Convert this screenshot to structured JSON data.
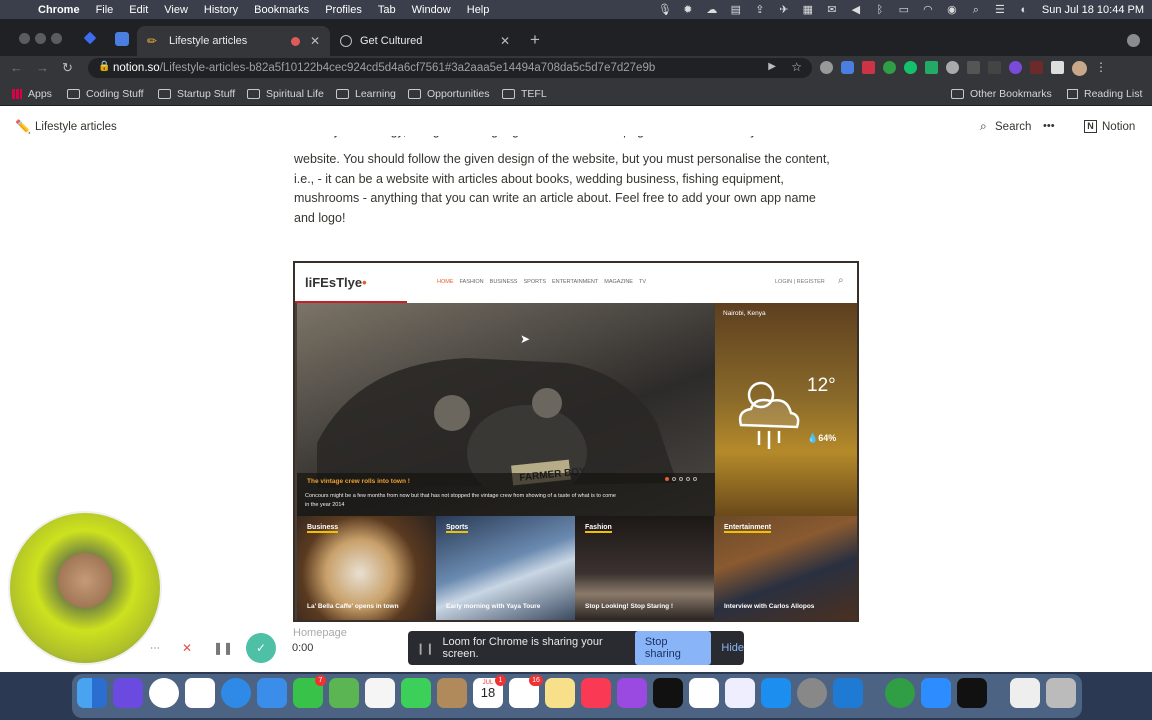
{
  "menubar": {
    "apple": "",
    "app": "Chrome",
    "items": [
      "File",
      "Edit",
      "View",
      "History",
      "Bookmarks",
      "Profiles",
      "Tab",
      "Window",
      "Help"
    ],
    "clock": "Sun Jul 18  10:44 PM"
  },
  "tabs": [
    {
      "title": "Lifestyle articles",
      "active": true
    },
    {
      "title": "Get Cultured",
      "active": false
    }
  ],
  "address": {
    "host": "notion.so",
    "path": "/Lifestyle-articles-b82a5f10122b4cec924cd5d4a6cf7561#3a2aaa5e14494a708da5c5d7e7d27e9b"
  },
  "bookmarks": {
    "apps": "Apps",
    "folders": [
      "Coding Stuff",
      "Startup Stuff",
      "Spiritual Life",
      "Learning",
      "Opportunities",
      "TEFL"
    ],
    "other": "Other Bookmarks",
    "reading": "Reading List"
  },
  "notion": {
    "page_title": "Lifestyle articles",
    "page_icon": "✏️",
    "search": "Search",
    "more": "•••",
    "notion_label": "Notion",
    "paragraph_lines": [
      "website. You should follow the given design of the website, but you must personalise the content,",
      "i.e., - it can be a website with articles about books, wedding business, fishing equipment,",
      "mushrooms - anything that you can write an article about. Feel free to add your own app name",
      "and logo!"
    ],
    "bottom_partial": "Homepage"
  },
  "mockup": {
    "logo": "liFEsTlye",
    "nav": [
      "HOME",
      "FASHION",
      "BUSINESS",
      "SPORTS",
      "ENTERTAINMENT",
      "MAGAZINE",
      "TV"
    ],
    "login": "LOGIN | REGISTER",
    "hero_title": "The vintage crew rolls into town !",
    "hero_desc_1": "Concours might be a few months from now but that has not  stopped the vintage crew from showing of  a taste of what is to come",
    "hero_desc_2": "in the year 2014",
    "plate": "FARMER BOY",
    "weather": {
      "city": "Nairobi, Kenya",
      "temp": "12°",
      "humidity": "64%"
    },
    "cards": [
      {
        "label": "Business",
        "caption": "La' Bella Caffe' opens in town"
      },
      {
        "label": "Sports",
        "caption": "Early morning with Yaya Toure"
      },
      {
        "label": "Fashion",
        "caption": "Stop Looking! Stop Staring !"
      },
      {
        "label": "Entertainment",
        "caption": "Interview with Carlos Allopos"
      }
    ]
  },
  "loom": {
    "timer": "0:00",
    "banner_text": "Loom for Chrome is sharing your screen.",
    "stop": "Stop sharing",
    "hide": "Hide"
  },
  "dock": {
    "calendar_month": "JUL",
    "calendar_day": "18",
    "badge_facetime": "7",
    "badge_reminders": "16",
    "badge_calendar": "1"
  },
  "colors": {
    "accent_orange": "#e85c2b",
    "loom_blue": "#8ab4f8",
    "chrome_dark": "#35363a"
  }
}
